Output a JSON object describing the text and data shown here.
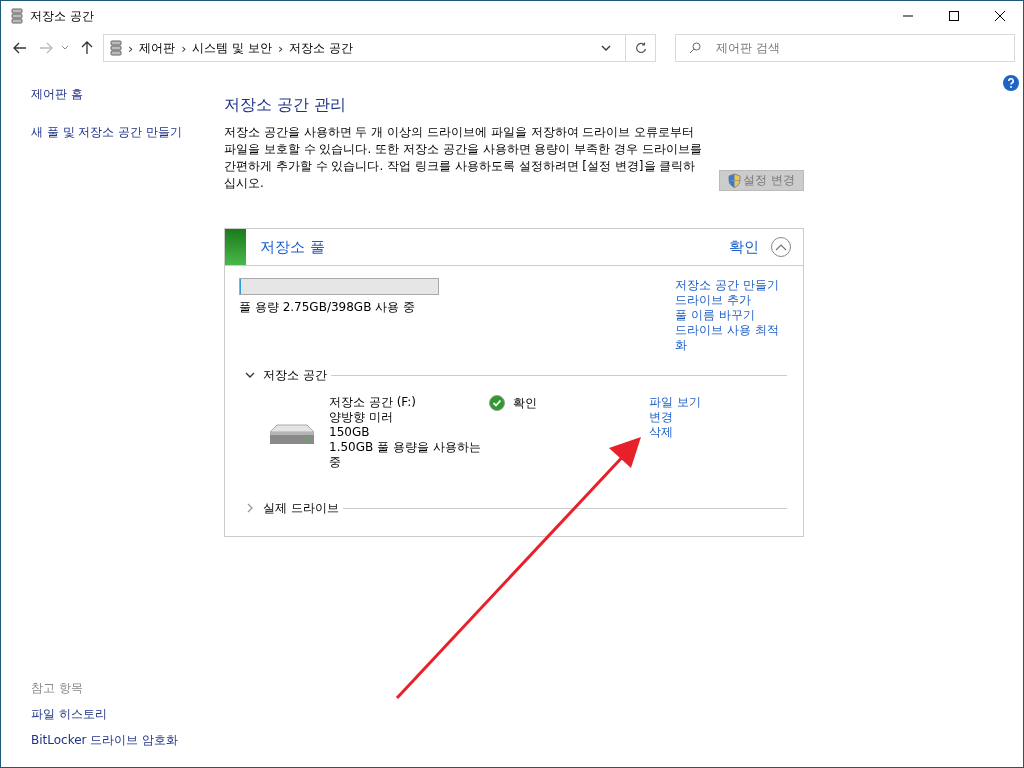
{
  "window": {
    "title": "저장소 공간"
  },
  "address_bar": {
    "breadcrumbs": [
      "제어판",
      "시스템 및 보안",
      "저장소 공간"
    ],
    "separator": "›"
  },
  "search": {
    "placeholder": "제어판 검색"
  },
  "sidebar": {
    "items": [
      {
        "label": "제어판 홈"
      },
      {
        "label": "새 풀 및 저장소 공간 만들기"
      }
    ],
    "see_also": {
      "heading": "참고 항목",
      "items": [
        {
          "label": "파일 히스토리"
        },
        {
          "label": "BitLocker 드라이브 암호화"
        }
      ]
    }
  },
  "main": {
    "heading": "저장소 공간 관리",
    "description": "저장소 공간을 사용하면 두 개 이상의 드라이브에 파일을 저장하여 드라이브 오류로부터 파일을 보호할 수 있습니다. 또한 저장소 공간을 사용하면 용량이 부족한 경우 드라이브를 간편하게 추가할 수 있습니다. 작업 링크를 사용하도록 설정하려면 [설정 변경]을 클릭하십시오.",
    "change_settings_button": {
      "label": "설정 변경",
      "disabled": true
    }
  },
  "pool": {
    "title": "저장소 풀",
    "status": "확인",
    "expanded": true,
    "usage": {
      "level": 0.007,
      "text": "풀 용량 2.75GB/398GB 사용 중"
    },
    "links": [
      "저장소 공간 만들기",
      "드라이브 추가",
      "풀 이름 바꾸기",
      "드라이브 사용 최적화"
    ],
    "sections": [
      {
        "title": "저장소 공간",
        "expanded": true,
        "spaces": [
          {
            "name": "저장소 공간 (F:)",
            "resiliency": "양방향 미러",
            "size": "150GB",
            "usage": "1.50GB 풀 용량을 사용하는 중",
            "status": "확인",
            "links": [
              "파일 보기",
              "변경",
              "삭제"
            ]
          }
        ]
      },
      {
        "title": "실제 드라이브",
        "expanded": false
      }
    ]
  }
}
